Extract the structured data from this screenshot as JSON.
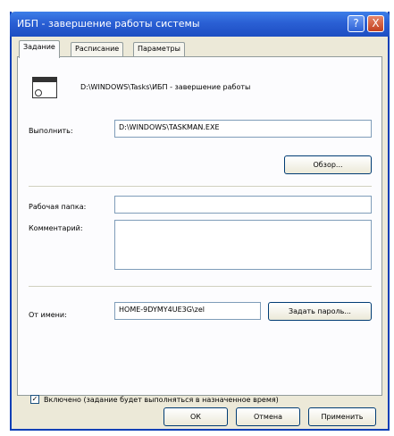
{
  "window": {
    "title": "ИБП - завершение работы системы",
    "help_label": "?",
    "close_label": "X"
  },
  "tabs": [
    {
      "label": "Задание"
    },
    {
      "label": "Расписание"
    },
    {
      "label": "Параметры"
    }
  ],
  "task": {
    "icon": "scheduled-task-icon",
    "path": "D:\\WINDOWS\\Tasks\\ИБП - завершение работы"
  },
  "run": {
    "label": "Выполнить:",
    "value": "D:\\WINDOWS\\TASKMAN.EXE",
    "browse_label": "Обзор..."
  },
  "workdir": {
    "label": "Рабочая папка:",
    "value": ""
  },
  "comment": {
    "label": "Комментарий:",
    "value": ""
  },
  "run_as": {
    "label": "От имени:",
    "value": "HOME-9DYMY4UE3G\\zel",
    "set_password_label": "Задать пароль..."
  },
  "enabled": {
    "checked": true,
    "label": "Включено (задание будет выполняться в назначенное время)"
  },
  "footer": {
    "ok_label": "ОК",
    "cancel_label": "Отмена",
    "apply_label": "Применить"
  }
}
